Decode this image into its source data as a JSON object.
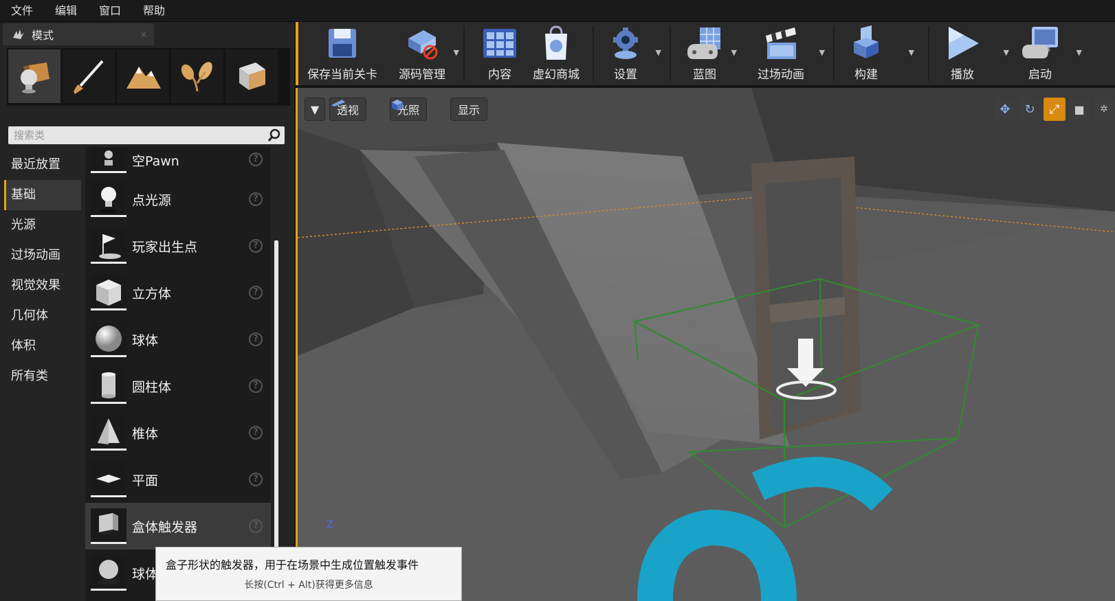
{
  "menu": [
    "文件",
    "编辑",
    "窗口",
    "帮助"
  ],
  "modes_panel": {
    "tab_label": "模式",
    "tab_close": "×",
    "mode_icons": [
      "place-mode-icon",
      "paint-mode-icon",
      "landscape-mode-icon",
      "foliage-mode-icon",
      "mesh-paint-mode-icon"
    ],
    "search_placeholder": "搜索类",
    "categories": [
      "最近放置",
      "基础",
      "光源",
      "过场动画",
      "视觉效果",
      "几何体",
      "体积",
      "所有类"
    ],
    "active_category": "基础",
    "items": [
      "空Pawn",
      "点光源",
      "玩家出生点",
      "立方体",
      "球体",
      "圆柱体",
      "椎体",
      "平面",
      "盒体触发器",
      "球体触发器"
    ],
    "visible_last_item": "球体",
    "hovered_item": "盒体触发器"
  },
  "toolbar": {
    "buttons": [
      {
        "label": "保存当前关卡",
        "icon": "save-icon"
      },
      {
        "label": "源码管理",
        "icon": "source-control-icon"
      },
      {
        "label": "内容",
        "icon": "content-icon"
      },
      {
        "label": "虚幻商城",
        "icon": "marketplace-icon"
      },
      {
        "label": "设置",
        "icon": "settings-icon"
      },
      {
        "label": "蓝图",
        "icon": "blueprint-icon"
      },
      {
        "label": "过场动画",
        "icon": "cinematics-icon"
      },
      {
        "label": "构建",
        "icon": "build-icon"
      },
      {
        "label": "播放",
        "icon": "play-icon"
      },
      {
        "label": "启动",
        "icon": "launch-icon"
      }
    ]
  },
  "viewport": {
    "perspective": "透视",
    "lit": "光照",
    "show": "显示",
    "axis_label": "Z"
  },
  "tooltip": {
    "text": "盒子形状的触发器，用于在场景中生成位置触发事件",
    "hint": "长按(Ctrl + Alt)获得更多信息"
  },
  "colors": {
    "accent": "#e8a317",
    "viewport_floor": "#5a5a5a",
    "trigger_box": "#2e8b2e",
    "floor_logo": "#1aa3c8"
  }
}
